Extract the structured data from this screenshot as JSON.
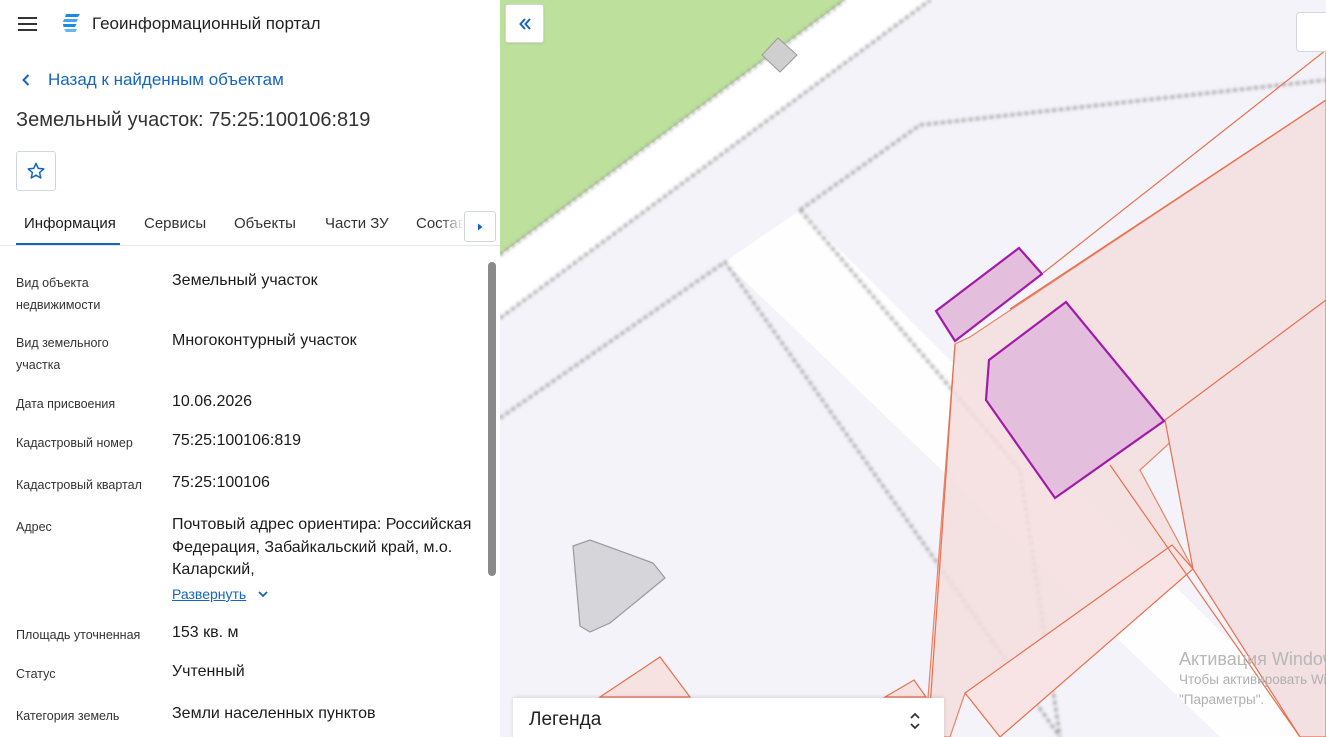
{
  "header": {
    "app_title": "Геоинформационный портал",
    "menu_icon": "hamburger-menu-icon",
    "logo_icon": "portal-logo-icon"
  },
  "navigation": {
    "back_label": "Назад к найденным объектам"
  },
  "object": {
    "title": "Земельный участок: 75:25:100106:819"
  },
  "tabs": [
    {
      "label": "Информация",
      "active": true
    },
    {
      "label": "Сервисы",
      "active": false
    },
    {
      "label": "Объекты",
      "active": false
    },
    {
      "label": "Части ЗУ",
      "active": false
    },
    {
      "label": "Состав",
      "active": false
    }
  ],
  "info": {
    "rows": [
      {
        "label": "Вид объекта недвижимости",
        "value": "Земельный участок"
      },
      {
        "label": "Вид земельного участка",
        "value": "Многоконтурный участок"
      },
      {
        "label": "Дата присвоения",
        "value": "10.06.2026"
      },
      {
        "label": "Кадастровый номер",
        "value": "75:25:100106:819"
      },
      {
        "label": "Кадастровый квартал",
        "value": "75:25:100106"
      },
      {
        "label": "Адрес",
        "value": "Почтовый адрес ориентира: Российская Федерация, Забайкальский край, м.о. Каларский,"
      },
      {
        "label": "Площадь уточненная",
        "value": "153 кв. м"
      },
      {
        "label": "Статус",
        "value": "Учтенный"
      },
      {
        "label": "Категория земель",
        "value": "Земли населенных пунктов"
      }
    ],
    "expand_label": "Развернуть"
  },
  "map": {
    "legend_title": "Легенда",
    "watermark": {
      "title": "Активация Windows",
      "line1": "Чтобы активировать Windows, перейдите в раздел",
      "line2": "\"Параметры\"."
    }
  },
  "colors": {
    "accent": "#1565c0",
    "parcel_fill": "#e3bfdd",
    "parcel_stroke": "#a21aa8",
    "zone_fill": "#f5dede",
    "zone_stroke": "#e8704e",
    "park": "#bde19c"
  }
}
